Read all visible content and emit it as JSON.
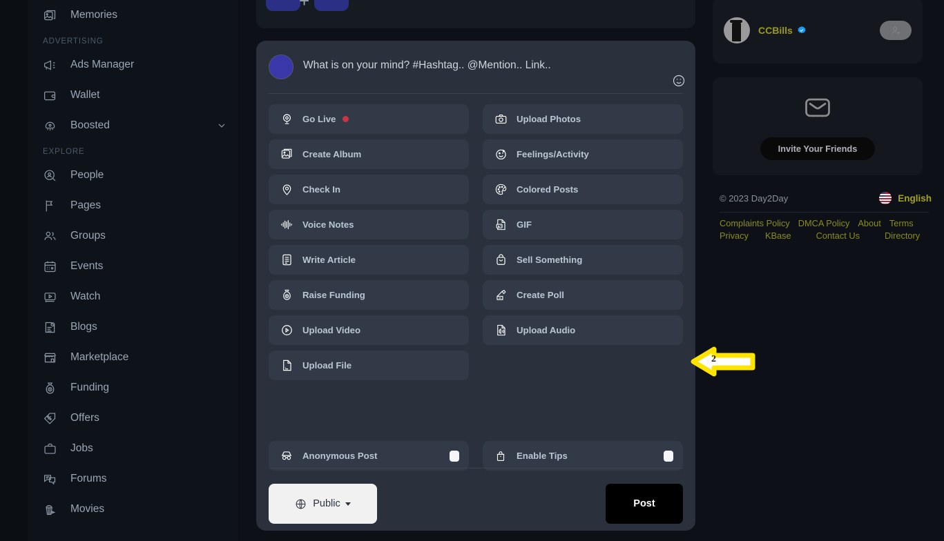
{
  "sidebar": {
    "items_top": [
      {
        "label": "Memories",
        "icon": "memories-icon"
      }
    ],
    "sections": [
      {
        "label": "ADVERTISING",
        "items": [
          {
            "label": "Ads Manager",
            "icon": "megaphone-icon"
          },
          {
            "label": "Wallet",
            "icon": "wallet-icon"
          },
          {
            "label": "Boosted",
            "icon": "rocket-icon",
            "chevron": true
          }
        ]
      },
      {
        "label": "EXPLORE",
        "items": [
          {
            "label": "People",
            "icon": "people-search-icon"
          },
          {
            "label": "Pages",
            "icon": "flag-icon"
          },
          {
            "label": "Groups",
            "icon": "groups-icon"
          },
          {
            "label": "Events",
            "icon": "calendar-icon"
          },
          {
            "label": "Watch",
            "icon": "video-play-icon"
          },
          {
            "label": "Blogs",
            "icon": "blog-icon"
          },
          {
            "label": "Marketplace",
            "icon": "store-icon"
          },
          {
            "label": "Funding",
            "icon": "money-bag-icon"
          },
          {
            "label": "Offers",
            "icon": "tag-percent-icon"
          },
          {
            "label": "Jobs",
            "icon": "briefcase-icon"
          },
          {
            "label": "Forums",
            "icon": "chat-bubbles-icon"
          },
          {
            "label": "Movies",
            "icon": "popcorn-icon"
          }
        ]
      }
    ]
  },
  "composer": {
    "placeholder": "What is on your mind? #Hashtag.. @Mention.. Link..",
    "emoji_icon": "smiley-icon",
    "options": [
      {
        "label": "Go Live",
        "icon": "webcam-icon",
        "dot": true
      },
      {
        "label": "Upload Photos",
        "icon": "camera-icon"
      },
      {
        "label": "Create Album",
        "icon": "album-icon"
      },
      {
        "label": "Feelings/Activity",
        "icon": "smiley-wink-icon"
      },
      {
        "label": "Check In",
        "icon": "location-pin-icon"
      },
      {
        "label": "Colored Posts",
        "icon": "palette-icon"
      },
      {
        "label": "Voice Notes",
        "icon": "waveform-icon"
      },
      {
        "label": "GIF",
        "icon": "gif-file-icon"
      },
      {
        "label": "Write Article",
        "icon": "document-lines-icon"
      },
      {
        "label": "Sell Something",
        "icon": "shopping-bag-icon"
      },
      {
        "label": "Raise Funding",
        "icon": "money-bag-icon"
      },
      {
        "label": "Create Poll",
        "icon": "poll-pen-icon"
      },
      {
        "label": "Upload Video",
        "icon": "video-circle-icon"
      },
      {
        "label": "Upload Audio",
        "icon": "audio-file-icon"
      },
      {
        "label": "Upload File",
        "icon": "file-icon"
      }
    ],
    "toggles": [
      {
        "label": "Anonymous Post",
        "icon": "incognito-icon",
        "checked": false
      },
      {
        "label": "Enable Tips",
        "icon": "tip-jar-icon",
        "checked": false
      }
    ],
    "privacy": {
      "label": "Public",
      "icon": "globe-icon"
    },
    "post_button": "Post"
  },
  "right": {
    "user": {
      "name": "CCBills",
      "verified": true,
      "add_friend_icon": "add-user-icon"
    },
    "invite": {
      "icon": "envelope-icon",
      "button_label": "Invite Your Friends"
    },
    "copyright": "© 2023 Day2Day",
    "language": {
      "label": "English",
      "flag": "us-flag-icon"
    },
    "footer_links": [
      "Complaints Policy",
      "DMCA Policy",
      "About",
      "Terms",
      "Privacy",
      "KBase",
      "Contact Us",
      "Directory"
    ]
  },
  "annotation": {
    "number": "2"
  },
  "colors": {
    "page_bg": "#0d1117",
    "sidebar_bg": "#0e1319",
    "composer_bg": "#2a313c",
    "option_bg": "#323a47",
    "option_text": "#b9c6d4",
    "accent_olive": "#8c8c18",
    "live_dot": "#cc3344",
    "annotation_border": "#ffe400",
    "post_btn_bg": "#000000"
  }
}
